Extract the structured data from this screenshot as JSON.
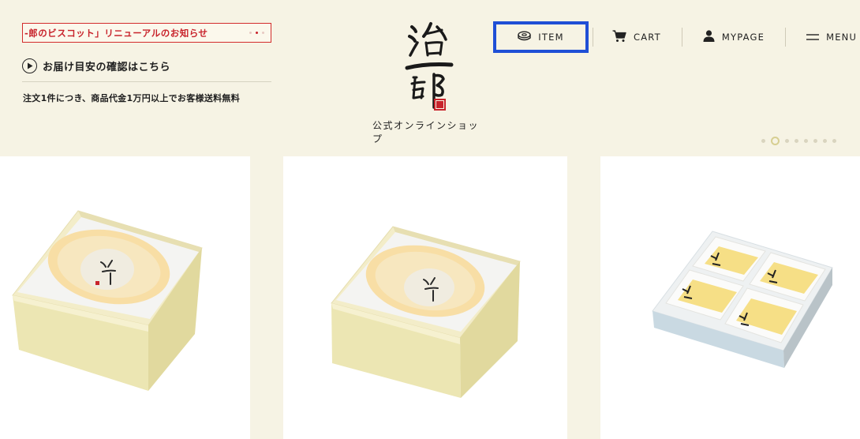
{
  "news": {
    "text": "-郎のビスコット」リニューアルのお知らせ"
  },
  "delivery": {
    "label": "お届け目安の確認はこちら"
  },
  "shipping": {
    "note": "注文1件につき、商品代金1万円以上でお客様送料無料"
  },
  "logo": {
    "subtitle": "公式オンラインショップ"
  },
  "nav": {
    "item": {
      "label": "ITEM",
      "icon": "baumkuchen-icon"
    },
    "cart": {
      "label": "CART",
      "icon": "cart-icon"
    },
    "mypage": {
      "label": "MYPAGE",
      "icon": "user-icon"
    },
    "menu": {
      "label": "MENU",
      "icon": "hamburger-icon"
    }
  },
  "carousel": {
    "total_slides": 8,
    "active_index": 1
  },
  "colors": {
    "background": "#f6f3e4",
    "accent_red": "#c8232b",
    "highlight_blue": "#1f4fd6",
    "dot_active": "#d7cf92"
  },
  "products": [
    {
      "image": "baumkuchen-gold-box-large"
    },
    {
      "image": "baumkuchen-gold-box-medium"
    },
    {
      "image": "cake-slices-4-pack-box"
    }
  ]
}
